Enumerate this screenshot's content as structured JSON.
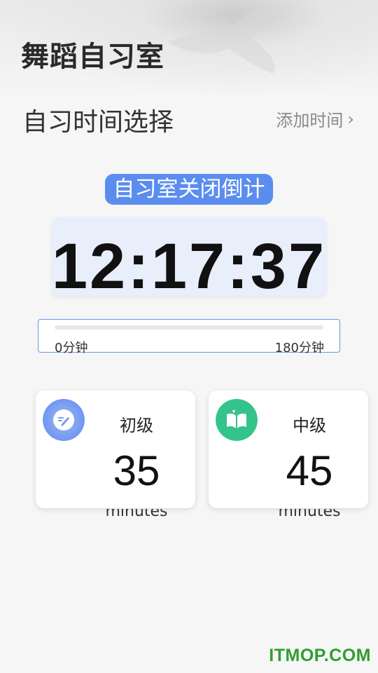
{
  "header": {
    "app_title": "舞蹈自习室"
  },
  "section": {
    "title": "自习时间选择",
    "add_time_label": "添加时间",
    "add_time_chevron": "›"
  },
  "countdown": {
    "badge_label": "自习室关闭倒计",
    "time": "12:17:37"
  },
  "duration_slider": {
    "min_label": "0分钟",
    "max_label": "180分钟"
  },
  "levels": [
    {
      "name": "初级",
      "value": "35",
      "unit": "minutes",
      "icon": "pencil-edit-icon",
      "icon_color": "#6f97f0"
    },
    {
      "name": "中级",
      "value": "45",
      "unit": "minutes",
      "icon": "open-book-icon",
      "icon_color": "#34c48b"
    }
  ],
  "watermark": {
    "text": "ITMOP.COM",
    "color": "#2f9e2f"
  },
  "colors": {
    "accent": "#5b8def",
    "slider_border": "#6a93e8",
    "clock_card": "#e9eefb"
  }
}
